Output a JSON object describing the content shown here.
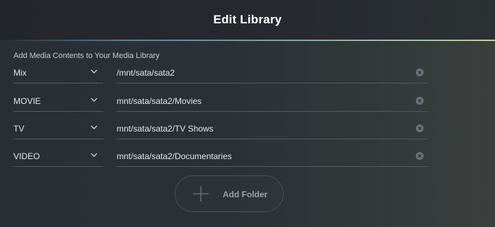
{
  "dialog": {
    "title": "Edit Library",
    "subtitle": "Add Media Contents to Your Media Library"
  },
  "rows": [
    {
      "type": "Mix",
      "path": "/mnt/sata/sata2"
    },
    {
      "type": "MOVIE",
      "path": "mnt/sata/sata2/Movies"
    },
    {
      "type": "TV",
      "path": "mnt/sata/sata2/TV Shows"
    },
    {
      "type": "VIDEO",
      "path": "mnt/sata/sata2/Documentaries"
    }
  ],
  "add_folder": {
    "label": "Add Folder"
  },
  "icons": {
    "dropdown": "chevron-down-icon",
    "clear": "clear-circle-icon",
    "add": "plus-icon"
  },
  "colors": {
    "background": "#2a2f35",
    "accent_start": "#5b7a93",
    "accent_end": "#b9d39b"
  }
}
